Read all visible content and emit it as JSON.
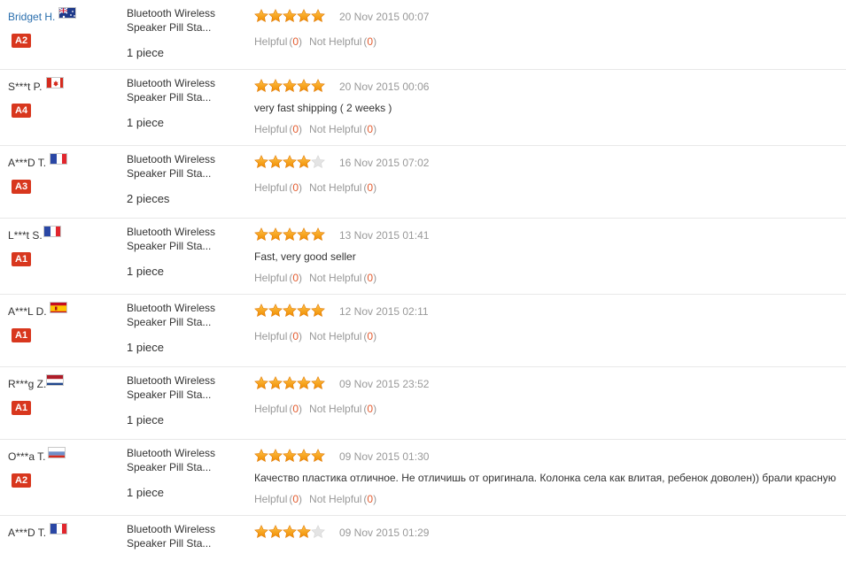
{
  "helpful_label": "Helpful",
  "not_helpful_label": "Not Helpful",
  "reviews": [
    {
      "user": "Bridget H.",
      "flag": "au-flag-icon",
      "level": "A2",
      "product": "Bluetooth Wireless Speaker Pill Sta...",
      "qty": "1 piece",
      "rating": 5,
      "date": "20 Nov 2015 00:07",
      "comment": "",
      "helpful": "0",
      "not_helpful": "0"
    },
    {
      "user": "S***t P.",
      "flag": "ca-flag-icon",
      "level": "A4",
      "product": "Bluetooth Wireless Speaker Pill Sta...",
      "qty": "1 piece",
      "rating": 5,
      "date": "20 Nov 2015 00:06",
      "comment": "very fast shipping ( 2 weeks )",
      "helpful": "0",
      "not_helpful": "0"
    },
    {
      "user": "A***D T.",
      "flag": "fr-flag-icon",
      "level": "A3",
      "product": "Bluetooth Wireless Speaker Pill Sta...",
      "qty": "2 pieces",
      "rating": 4,
      "date": "16 Nov 2015 07:02",
      "comment": "",
      "helpful": "0",
      "not_helpful": "0"
    },
    {
      "user": "L***t S.",
      "flag": "fr-flag-icon",
      "level": "A1",
      "product": "Bluetooth Wireless Speaker Pill Sta...",
      "qty": "1 piece",
      "rating": 5,
      "date": "13 Nov 2015 01:41",
      "comment": "Fast, very good seller",
      "helpful": "0",
      "not_helpful": "0"
    },
    {
      "user": "A***L D.",
      "flag": "es-flag-icon",
      "level": "A1",
      "product": "Bluetooth Wireless Speaker Pill Sta...",
      "qty": "1 piece",
      "rating": 5,
      "date": "12 Nov 2015 02:11",
      "comment": "",
      "helpful": "0",
      "not_helpful": "0"
    },
    {
      "user": "R***g Z.",
      "flag": "nl-flag-icon",
      "level": "A1",
      "product": "Bluetooth Wireless Speaker Pill Sta...",
      "qty": "1 piece",
      "rating": 5,
      "date": "09 Nov 2015 23:52",
      "comment": "",
      "helpful": "0",
      "not_helpful": "0"
    },
    {
      "user": "O***a T.",
      "flag": "ru-flag-icon",
      "level": "A2",
      "product": "Bluetooth Wireless Speaker Pill Sta...",
      "qty": "1 piece",
      "rating": 5,
      "date": "09 Nov 2015 01:30",
      "comment": "Качество пластика отличное. Не отличишь от оригинала. Колонка села как влитая, ребенок доволен)) брали красную",
      "helpful": "0",
      "not_helpful": "0"
    },
    {
      "user": "A***D T.",
      "flag": "fr-flag-icon",
      "level": "",
      "product": "Bluetooth Wireless Speaker Pill Sta...",
      "qty": "",
      "rating": 4,
      "date": "09 Nov 2015 01:29",
      "comment": "",
      "helpful": "",
      "not_helpful": ""
    }
  ]
}
